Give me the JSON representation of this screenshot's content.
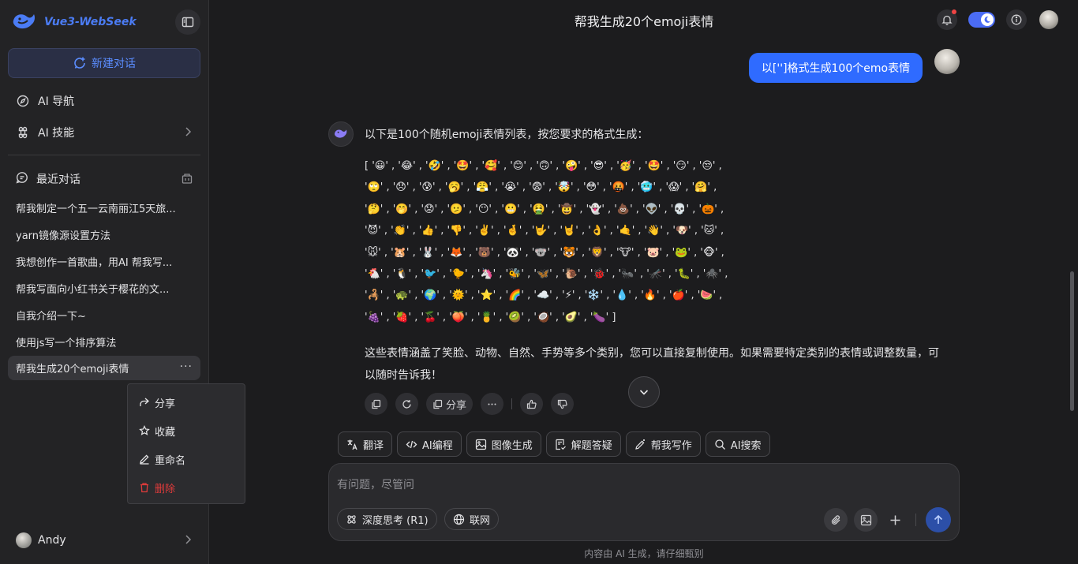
{
  "sidebar": {
    "brand": "Vue3-WebSeek",
    "new_chat": "新建对话",
    "nav": [
      {
        "label": "AI 导航",
        "icon": "compass-icon"
      },
      {
        "label": "AI 技能",
        "icon": "command-icon"
      }
    ],
    "recent_title": "最近对话",
    "conversations": [
      "帮我制定一个五一云南丽江5天旅...",
      "yarn镜像源设置方法",
      "我想创作一首歌曲，用AI 帮我写...",
      "帮我写面向小红书关于樱花的文...",
      "自我介绍一下~",
      "使用js写一个排序算法",
      "帮我生成20个emoji表情"
    ],
    "active_more": "···",
    "context_menu": [
      "分享",
      "收藏",
      "重命名",
      "删除"
    ],
    "user_name": "Andy"
  },
  "header": {
    "title": "帮我生成20个emoji表情"
  },
  "chat": {
    "user_message": "以['']格式生成100个emo表情",
    "bot_intro": "以下是100个随机emoji表情列表，按您要求的格式生成：",
    "emoji_lines": [
      "[ '😀' , '😂' , '🤣' , '🤩' , '🥰' , '😊' , '🙃' , '🤪' , '😎' , '🥳' , '🤩' , '😏' , '😒' ,",
      "  '🙄' , '😞' , '😰' , '🥱' , '😤' , '😭' , '😨' , '🤯' , '😳' , '🤬' , '🥶' , '😱' , '🤗' ,",
      "  '🤔' , '🤭' , '😟' , '🫤' , '😶' , '😬' , '🤮' , '🤠' , '👻' , '💩' , '👽' , '💀' , '🎃' ,",
      "  '😈' , '👏' , '👍' , '👎' , '✌️' , '🤞' , '🤟' , '🤘' , '👌' , '🤙' , '👋' , '🐶' , '🐱' ,",
      "  '🐭' , '🐹' , '🐰' , '🦊' , '🐻' , '🐼' , '🐨' , '🐯' , '🦁' , '🐮' , '🐷' , '🐸' , '🐵' ,",
      "  '🐔' , '🐧' , '🐦' , '🐤' , '🦄' , '🐝' , '🦋' , '🐌' , '🐞' , '🐜' , '🦟' , '🐛' , '🕷️' ,",
      "  '🦂' , '🐢' , '🌍' , '🌞' , '⭐' , '🌈' , '☁️' , '⚡' , '❄️' , '💧' , '🔥' , '🍎' , '🍉' ,",
      "  '🍇' , '🍓' , '🍒' , '🍑' , '🍍' , '🥝' , '🥥' , '🥑' , '🍆' ]"
    ],
    "bot_outro": "这些表情涵盖了笑脸、动物、自然、手势等多个类别，您可以直接复制使用。如果需要特定类别的表情或调整数量，可以随时告诉我！",
    "share_label": "分享"
  },
  "tools": [
    "翻译",
    "AI编程",
    "图像生成",
    "解题答疑",
    "帮我写作",
    "AI搜索"
  ],
  "input": {
    "placeholder": "有问题，尽管问",
    "deep_think": "深度思考 (R1)",
    "web": "联网"
  },
  "disclaimer": "内容由 AI 生成，请仔细甄别",
  "colors": {
    "accent": "#2f6bff",
    "brand": "#4b7cf5",
    "danger": "#e03b3b",
    "background": "#1c1c1e",
    "sidebar": "#232325"
  }
}
